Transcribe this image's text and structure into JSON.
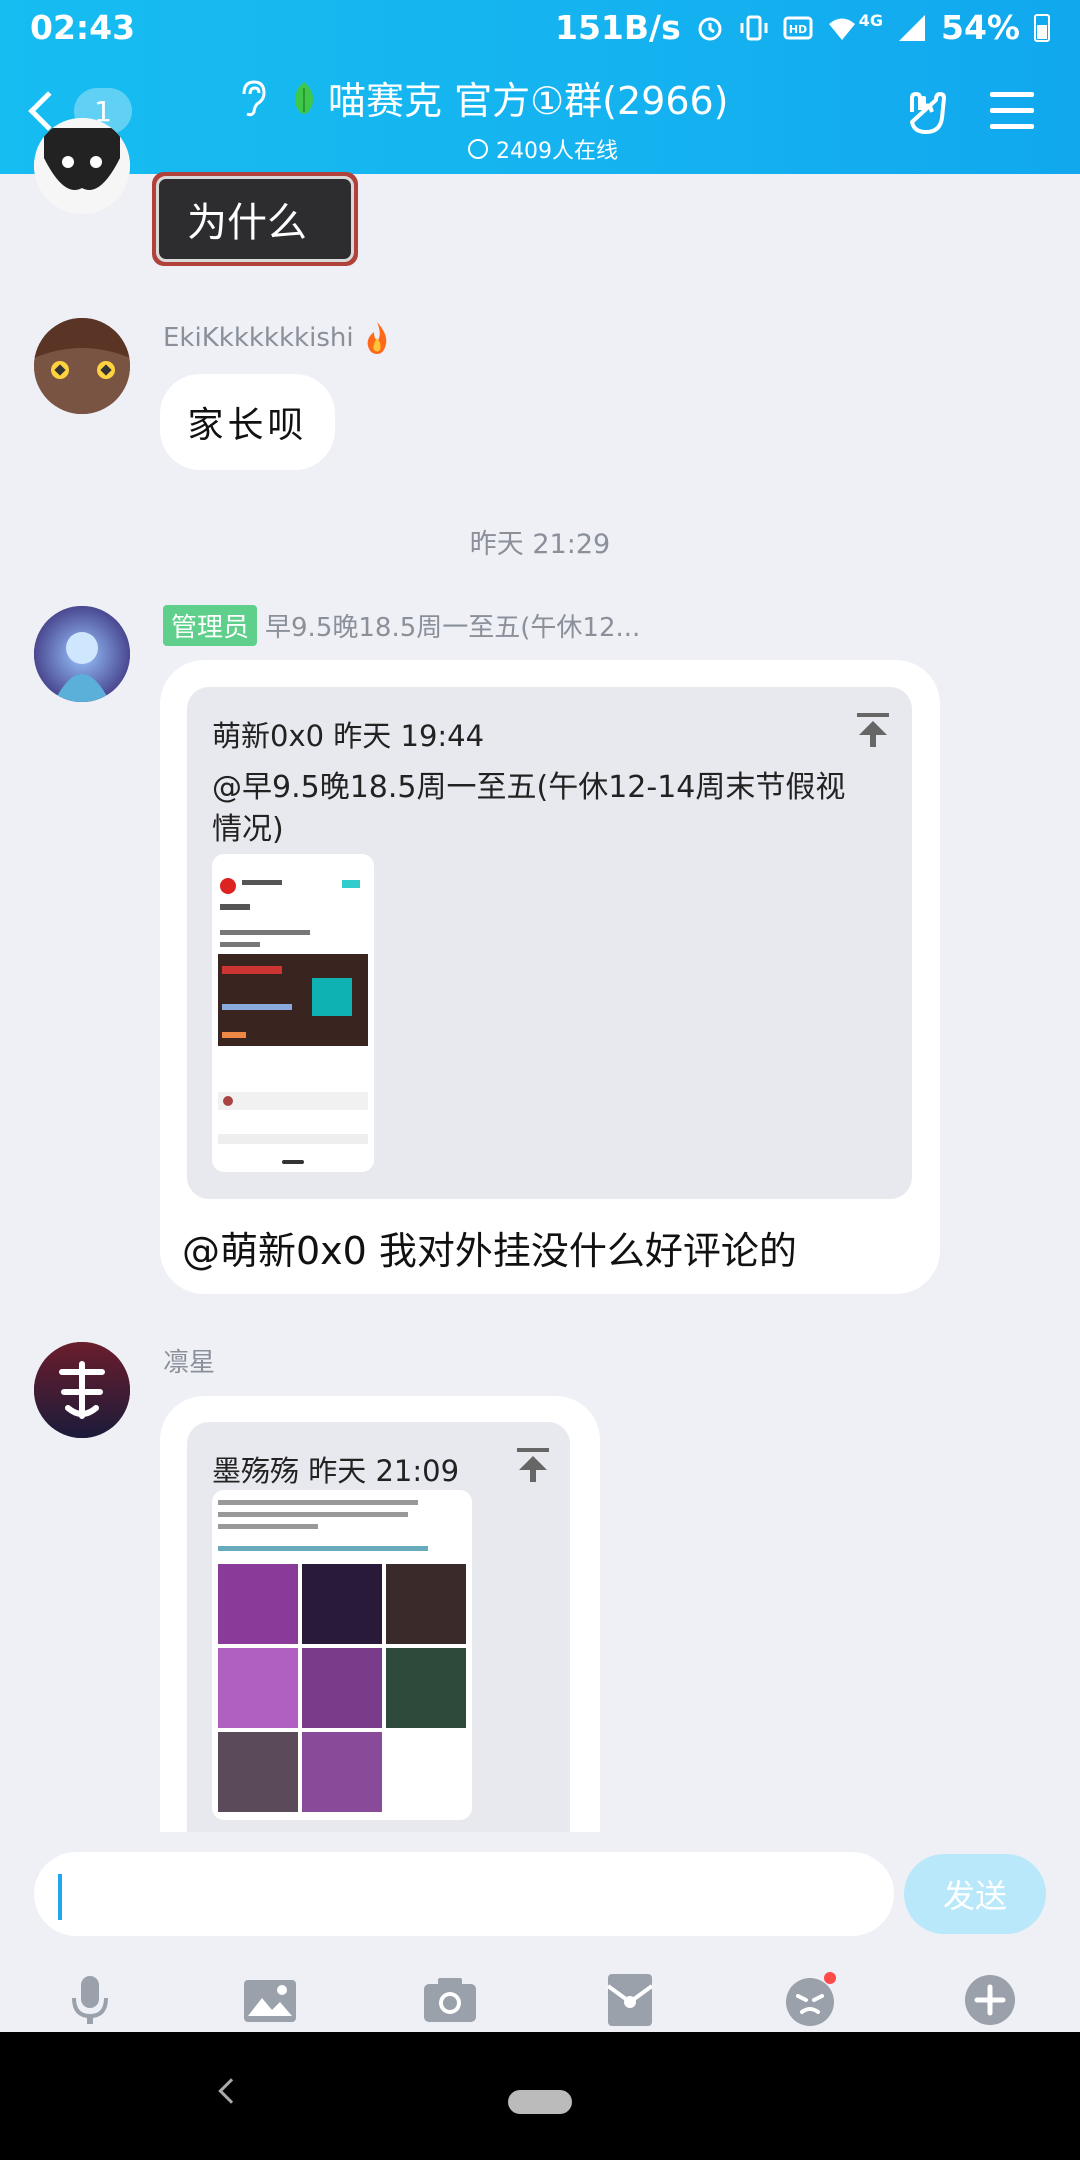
{
  "status_bar": {
    "time": "02:43",
    "net_speed": "151B/s",
    "net_type": "4G",
    "battery": "54%"
  },
  "header": {
    "back_count": "1",
    "title": "喵赛克 官方①群(2966)",
    "online": "2409人在线",
    "icons": [
      "ear-icon",
      "leaf-icon",
      "hand-rock-icon",
      "menu-icon"
    ]
  },
  "messages": [
    {
      "nick": "",
      "text": "为什么",
      "type": "sticker"
    },
    {
      "nick": "EkiKkkkkkkishi",
      "text": "家长呗",
      "type": "text"
    },
    {
      "separator": "昨天 21:29"
    },
    {
      "role": "管理员",
      "nick": "早9.5晚18.5周一至五(午休12...",
      "quote": {
        "author": "萌新0x0",
        "time": "昨天 19:44",
        "text": "@早9.5晚18.5周一至五(午休12-14周末节假视情况)"
      },
      "text": "@萌新0x0 我对外挂没什么好评论的"
    },
    {
      "nick": "凛星",
      "quote": {
        "author": "墨殇殇",
        "time": "昨天 21:09"
      }
    }
  ],
  "input": {
    "placeholder": "",
    "send_label": "发送"
  },
  "toolbar": [
    "mic-icon",
    "image-icon",
    "camera-icon",
    "redpacket-icon",
    "emoji-icon",
    "plus-icon"
  ],
  "colors": {
    "header": "#16bdf1",
    "accent": "#1fa8ef",
    "send_disabled": "#b9e8fb",
    "admin_tag": "#5fcf8c"
  }
}
